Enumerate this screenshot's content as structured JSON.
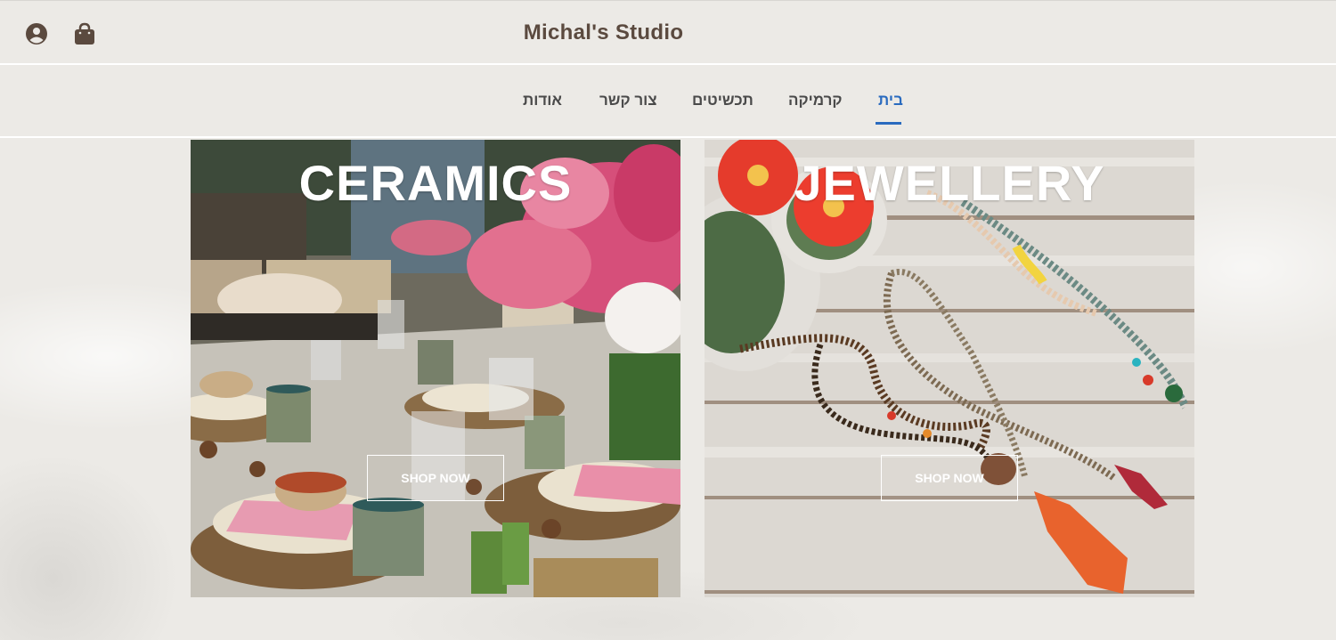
{
  "header": {
    "title": "Michal's Studio",
    "icons": [
      "account-icon",
      "shopping-bag-icon"
    ],
    "icon_color": "#5b4a3f"
  },
  "nav": {
    "items": [
      {
        "label": "בית",
        "active": true
      },
      {
        "label": "קרמיקה",
        "active": false
      },
      {
        "label": "תכשיטים",
        "active": false
      },
      {
        "label": "צור קשר",
        "active": false
      },
      {
        "label": "אודות",
        "active": false
      }
    ],
    "active_color": "#2a6bbf"
  },
  "cards": [
    {
      "title": "CERAMICS",
      "button": "SHOP NOW"
    },
    {
      "title": "JEWELLERY",
      "button": "SHOP NOW"
    }
  ]
}
